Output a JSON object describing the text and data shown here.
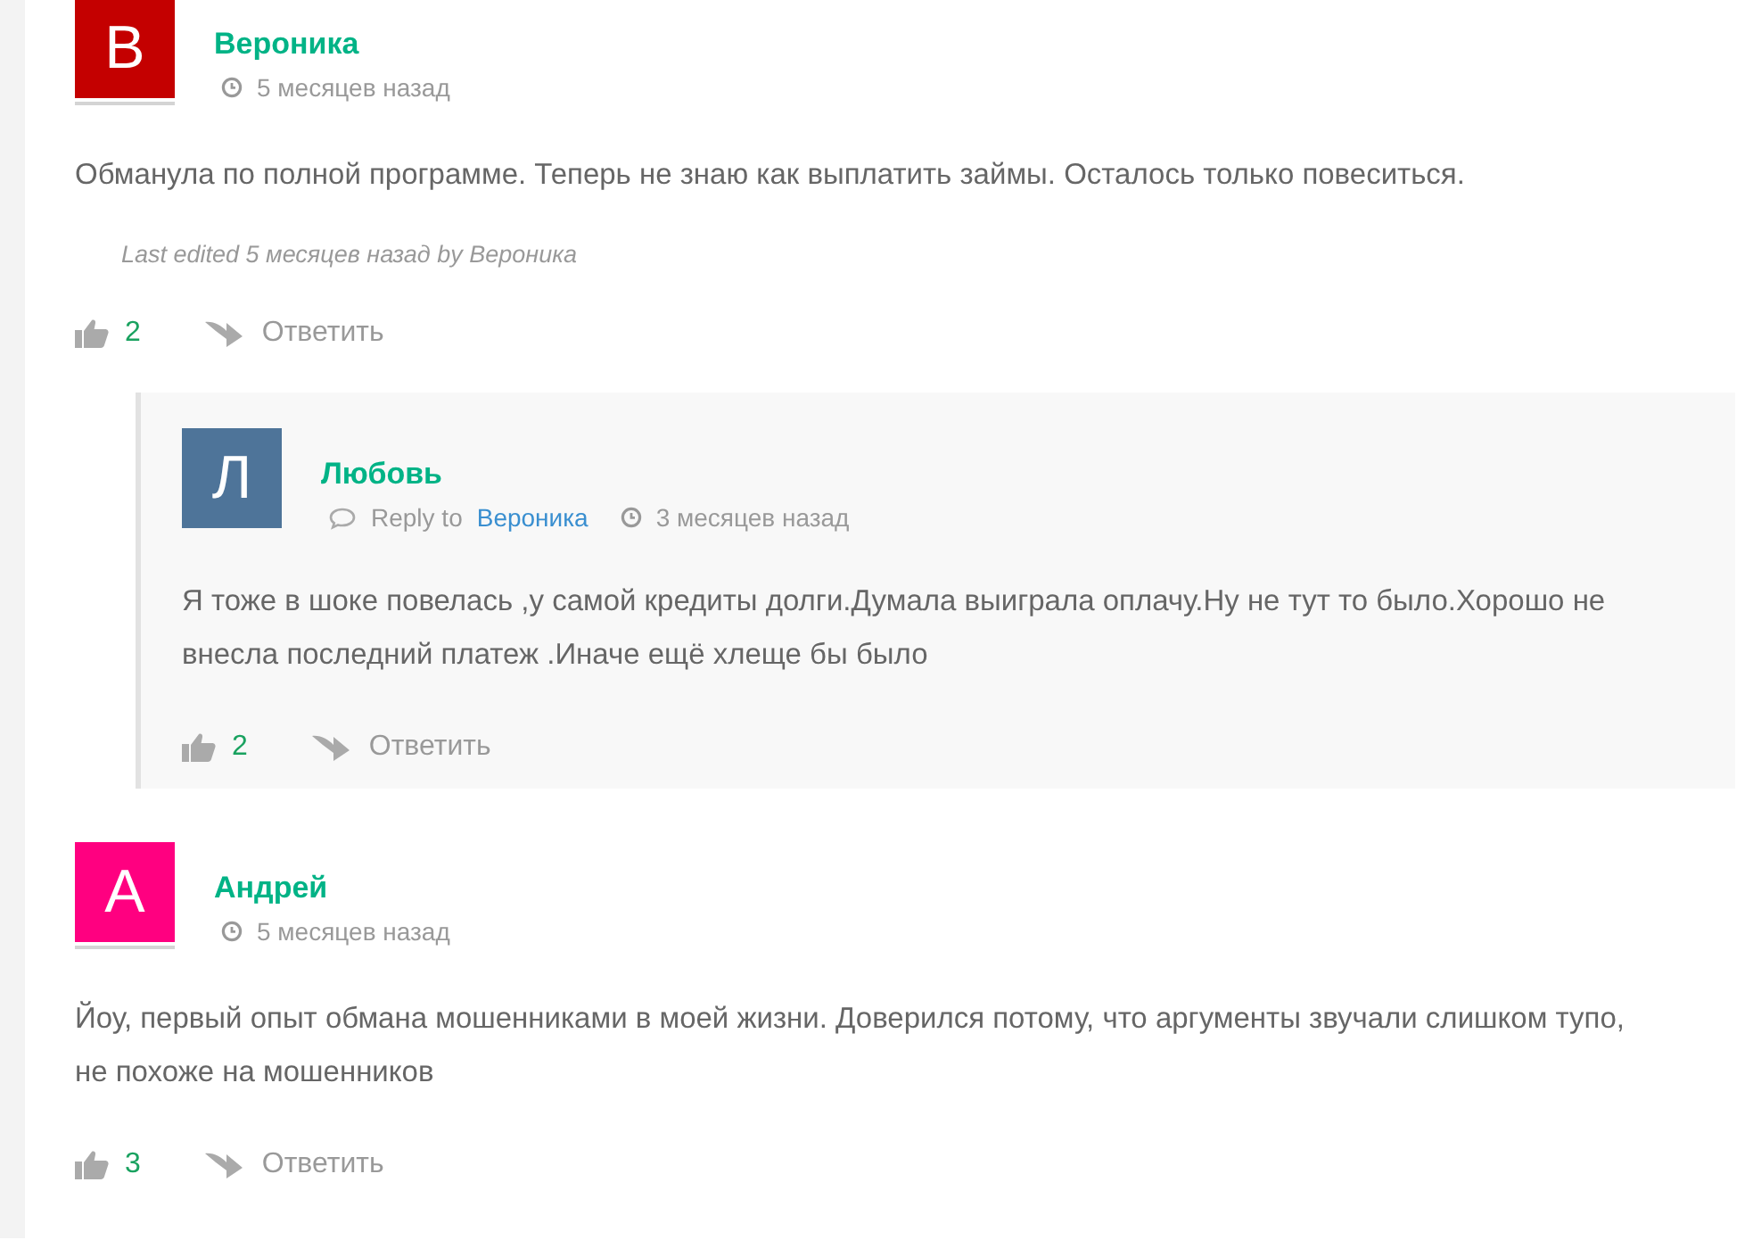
{
  "comments": [
    {
      "letter": "В",
      "color": "#c40000",
      "name": "Вероника",
      "time": "5 месяцев назад",
      "text": "Обманула по полной программе. Теперь не знаю как выплатить займы. Осталось только повеситься.",
      "edited": "Last edited 5 месяцев назад by Вероника",
      "likes": "2",
      "reply": "Ответить",
      "children": [
        {
          "letter": "Л",
          "color": "#4e7499",
          "name": "Любовь",
          "reply_label": "Reply to",
          "reply_to": "Вероника",
          "time": "3 месяцев назад",
          "text": "Я тоже в шоке повелась ,у самой кредиты долги.Думала выиграла оплачу.Ну не тут то было.Хорошо не внесла последний платеж .Иначе ещё хлеще бы было",
          "likes": "2",
          "reply": "Ответить"
        }
      ]
    },
    {
      "letter": "А",
      "color": "#ff0080",
      "name": "Андрей",
      "time": "5 месяцев назад",
      "text": "Йоу, первый опыт обмана мошенниками в моей жизни. Доверился потому, что аргументы звучали слишком тупо, не похоже на мошенников",
      "likes": "3",
      "reply": "Ответить"
    }
  ]
}
